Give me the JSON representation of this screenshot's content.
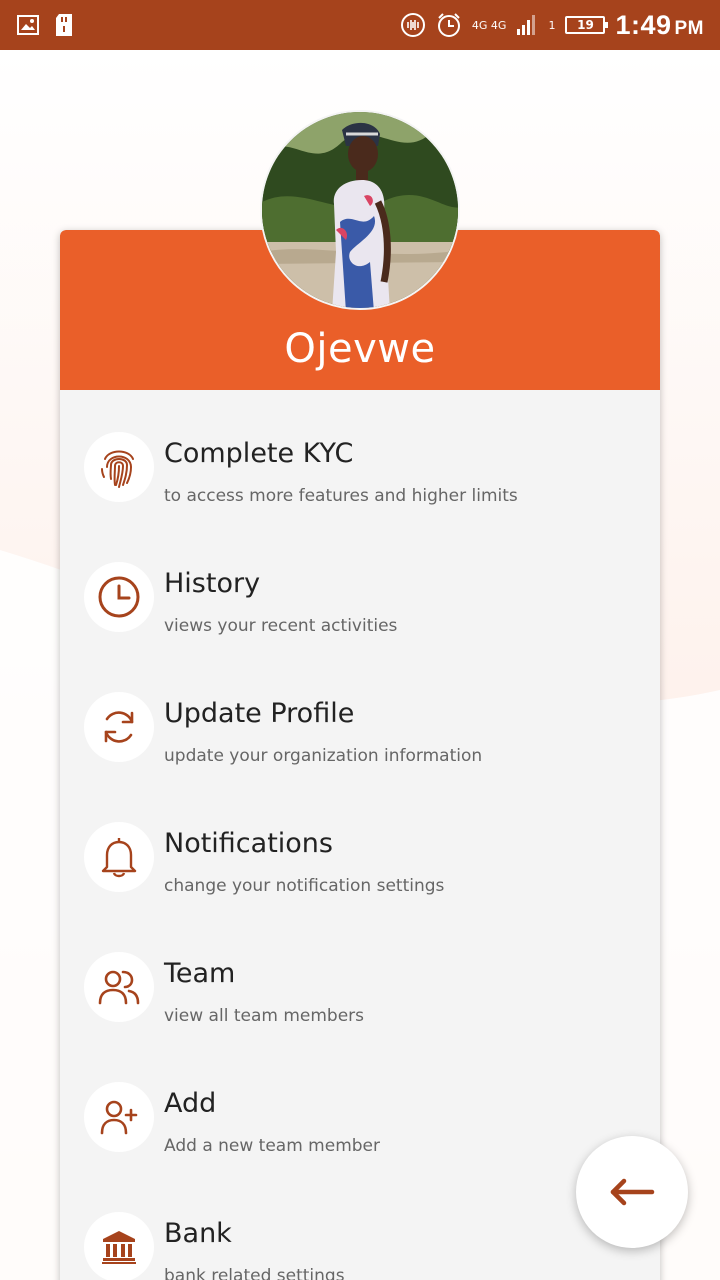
{
  "status_bar": {
    "network_a": "4G",
    "network_b": "4G",
    "sim_slot": "1",
    "battery": "19",
    "time": "1:49",
    "ampm": "PM"
  },
  "profile": {
    "name": "Ojevwe"
  },
  "menu": {
    "items": [
      {
        "title": "Complete KYC",
        "subtitle": "to access more features and higher limits",
        "icon": "fingerprint-icon"
      },
      {
        "title": "History",
        "subtitle": "views your recent activities",
        "icon": "clock-icon"
      },
      {
        "title": "Update Profile",
        "subtitle": "update your organization information",
        "icon": "refresh-icon"
      },
      {
        "title": "Notifications",
        "subtitle": "change your notification settings",
        "icon": "bell-icon"
      },
      {
        "title": "Team",
        "subtitle": "view all team members",
        "icon": "users-icon"
      },
      {
        "title": "Add",
        "subtitle": "Add a new team member",
        "icon": "user-plus-icon"
      },
      {
        "title": "Bank",
        "subtitle": "bank related settings",
        "icon": "bank-icon"
      }
    ]
  },
  "colors": {
    "status_bar": "#a6431c",
    "header": "#ea5f29",
    "icon": "#a6431c",
    "card": "#f4f4f4"
  }
}
